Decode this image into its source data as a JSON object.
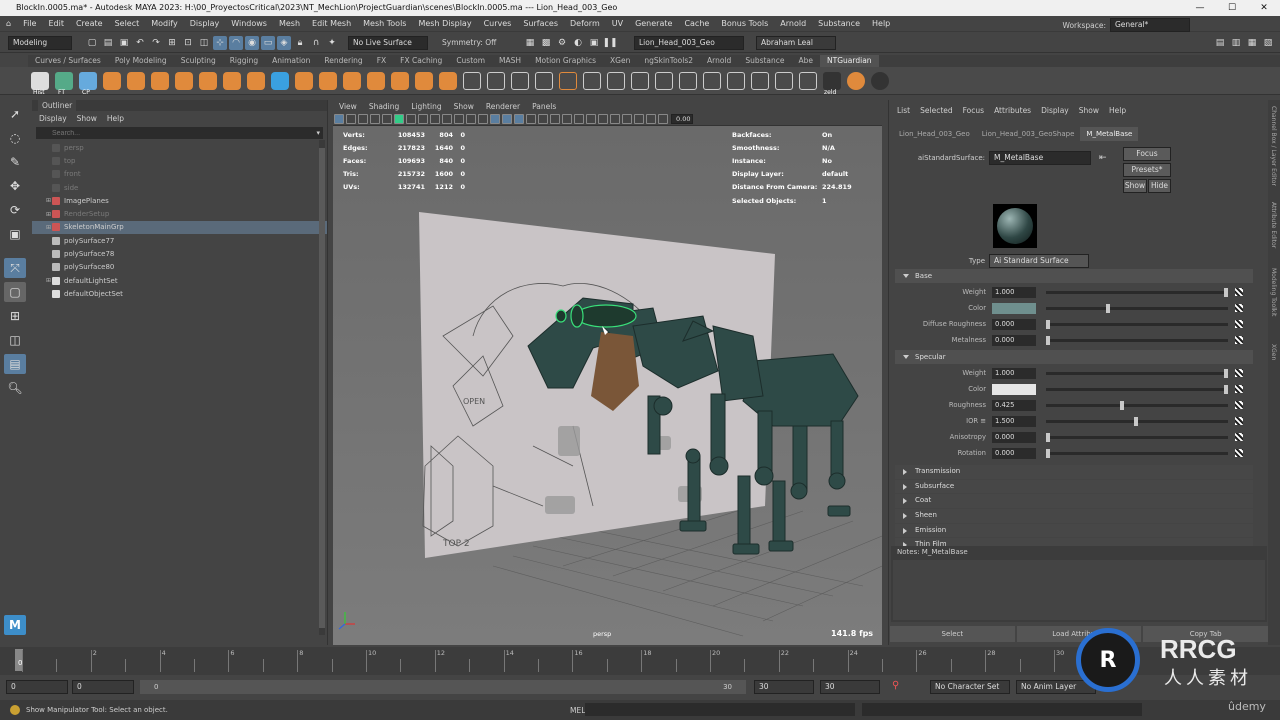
{
  "window": {
    "title": "BlockIn.0005.ma* - Autodesk MAYA 2023: H:\\00_ProyectosCritical\\2023\\NT_MechLion\\ProjectGuardian\\scenes\\BlockIn.0005.ma  ---  Lion_Head_003_Geo",
    "controls": [
      "—",
      "☐",
      "✕"
    ]
  },
  "menubar": {
    "items": [
      "File",
      "Edit",
      "Create",
      "Select",
      "Modify",
      "Display",
      "Windows",
      "Mesh",
      "Edit Mesh",
      "Mesh Tools",
      "Mesh Display",
      "Curves",
      "Surfaces",
      "Deform",
      "UV",
      "Generate",
      "Cache",
      "Bonus Tools",
      "Arnold",
      "Substance",
      "Help"
    ],
    "workspace_label": "Workspace:",
    "workspace_value": "General*"
  },
  "statusline": {
    "mode": "Modeling",
    "live_surface": "No Live Surface",
    "symmetry": "Symmetry: Off",
    "object_field": "Lion_Head_003_Geo",
    "user": "Abraham Leal"
  },
  "shelf": {
    "tabs": [
      "Curves / Surfaces",
      "Poly Modeling",
      "Sculpting",
      "Rigging",
      "Animation",
      "Rendering",
      "FX",
      "FX Caching",
      "Custom",
      "MASH",
      "Motion Graphics",
      "XGen",
      "ngSkinTools2",
      "Arnold",
      "Substance",
      "Abe",
      "NTGuardian"
    ],
    "active_tab": "NTGuardian",
    "labels": [
      "Hist",
      "FT",
      "CP",
      "zeld"
    ]
  },
  "outliner": {
    "title": "Outliner",
    "menu": [
      "Display",
      "Show",
      "Help"
    ],
    "search_placeholder": "Search...",
    "items": [
      {
        "label": "persp",
        "dim": true,
        "type": "camera"
      },
      {
        "label": "top",
        "dim": true,
        "type": "camera"
      },
      {
        "label": "front",
        "dim": true,
        "type": "camera"
      },
      {
        "label": "side",
        "dim": true,
        "type": "camera"
      },
      {
        "label": "ImagePlanes",
        "dim": false,
        "type": "group",
        "expand": true
      },
      {
        "label": "RenderSetup",
        "dim": true,
        "type": "group",
        "expand": true
      },
      {
        "label": "SkeletonMainGrp",
        "dim": false,
        "type": "group",
        "expand": true,
        "selected": true
      },
      {
        "label": "polySurface77",
        "dim": false,
        "type": "mesh"
      },
      {
        "label": "polySurface78",
        "dim": false,
        "type": "mesh"
      },
      {
        "label": "polySurface80",
        "dim": false,
        "type": "mesh"
      },
      {
        "label": "defaultLightSet",
        "dim": false,
        "type": "set",
        "expand": true
      },
      {
        "label": "defaultObjectSet",
        "dim": false,
        "type": "set"
      }
    ]
  },
  "viewport": {
    "menu": [
      "View",
      "Shading",
      "Lighting",
      "Show",
      "Renderer",
      "Panels"
    ],
    "exposure": "0.00",
    "stats_left": [
      {
        "label": "Verts:",
        "v1": "108453",
        "v2": "804",
        "v3": "0"
      },
      {
        "label": "Edges:",
        "v1": "217823",
        "v2": "1640",
        "v3": "0"
      },
      {
        "label": "Faces:",
        "v1": "109693",
        "v2": "840",
        "v3": "0"
      },
      {
        "label": "Tris:",
        "v1": "215732",
        "v2": "1600",
        "v3": "0"
      },
      {
        "label": "UVs:",
        "v1": "132741",
        "v2": "1212",
        "v3": "0"
      }
    ],
    "stats_right": [
      {
        "label": "Backfaces:",
        "value": "On"
      },
      {
        "label": "Smoothness:",
        "value": "N/A"
      },
      {
        "label": "Instance:",
        "value": "No"
      },
      {
        "label": "Display Layer:",
        "value": "default"
      },
      {
        "label": "Distance From Camera:",
        "value": "224.819"
      },
      {
        "label": "Selected Objects:",
        "value": "1"
      }
    ],
    "camera": "persp",
    "fps": "141.8 fps",
    "sketch_text": [
      "OPEN",
      "TOP 2"
    ]
  },
  "attr": {
    "menu": [
      "List",
      "Selected",
      "Focus",
      "Attributes",
      "Display",
      "Show",
      "Help"
    ],
    "tabs": [
      "Lion_Head_003_Geo",
      "Lion_Head_003_GeoShape",
      "M_MetalBase"
    ],
    "active_tab": "M_MetalBase",
    "node_type_label": "aiStandardSurface:",
    "node_name": "M_MetalBase",
    "focus": "Focus",
    "presets": "Presets*",
    "show": "Show",
    "hide": "Hide",
    "type_label": "Type",
    "type_value": "Ai Standard Surface",
    "base": {
      "title": "Base",
      "weight": "1.000",
      "color_label": "Color",
      "color": "#6f8f8e",
      "diffuse_roughness": "0.000",
      "metalness": "0.000"
    },
    "specular": {
      "title": "Specular",
      "weight": "1.000",
      "color": "#e6e6e6",
      "roughness": "0.425",
      "ior": "1.500",
      "anisotropy": "0.000",
      "rotation": "0.000"
    },
    "labels": {
      "weight": "Weight",
      "color": "Color",
      "diffuse_roughness": "Diffuse Roughness",
      "metalness": "Metalness",
      "roughness": "Roughness",
      "ior": "IOR ≡",
      "anisotropy": "Anisotropy",
      "rotation": "Rotation"
    },
    "collapsed_sections": [
      "Transmission",
      "Subsurface",
      "Coat",
      "Sheen",
      "Emission",
      "Thin Film"
    ],
    "notes_label": "Notes:  M_MetalBase",
    "bottom_buttons": [
      "Select",
      "Load Attributes",
      "Copy Tab"
    ]
  },
  "right_strip": [
    "Channel Box / Layer Editor",
    "Attribute Editor",
    "Modeling Toolkit",
    "XGen"
  ],
  "timeline": {
    "ticks": [
      "0",
      "2",
      "4",
      "6",
      "8",
      "10",
      "12",
      "14",
      "16",
      "18",
      "20",
      "22",
      "24",
      "26",
      "28",
      "30"
    ],
    "current": "0"
  },
  "range": {
    "start": "0",
    "playback_start": "0",
    "slider_start": "0",
    "slider_end": "30",
    "playback_end": "30",
    "end": "30",
    "character_set": "No Character Set",
    "anim_layer": "No Anim Layer"
  },
  "helpline": {
    "message": "Show Manipulator Tool: Select an object.",
    "lang": "MEL"
  },
  "watermark": {
    "text1": "RRCG",
    "text2": "人人素材",
    "udemy": "ûdemy"
  }
}
